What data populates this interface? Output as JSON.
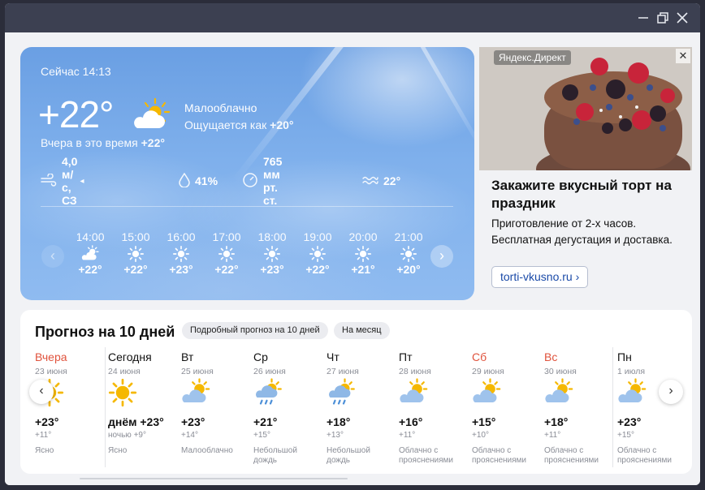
{
  "window": {
    "minimize_icon": "minimize-icon",
    "restore_icon": "restore-icon",
    "close_icon": "close-icon"
  },
  "now": {
    "label": "Сейчас 14:13",
    "temp": "+22°",
    "icon": "partly-cloudy-icon",
    "condition": "Малооблачно",
    "feels_prefix": "Ощущается как",
    "feels_value": "+20°",
    "yesterday_prefix": "Вчера в это время",
    "yesterday_value": "+22°",
    "wind": "4,0 м/с, СЗ",
    "humidity": "41%",
    "pressure": "765 мм рт. ст.",
    "water": "22°"
  },
  "hourly": [
    {
      "time": "14:00",
      "icon": "partly-cloudy-icon",
      "temp": "+22°"
    },
    {
      "time": "15:00",
      "icon": "sun-icon",
      "temp": "+22°"
    },
    {
      "time": "16:00",
      "icon": "sun-icon",
      "temp": "+23°"
    },
    {
      "time": "17:00",
      "icon": "sun-icon",
      "temp": "+22°"
    },
    {
      "time": "18:00",
      "icon": "sun-icon",
      "temp": "+23°"
    },
    {
      "time": "19:00",
      "icon": "sun-icon",
      "temp": "+22°"
    },
    {
      "time": "20:00",
      "icon": "sun-icon",
      "temp": "+21°"
    },
    {
      "time": "21:00",
      "icon": "sun-icon",
      "temp": "+20°"
    }
  ],
  "ad": {
    "tag": "Яндекс.Директ",
    "close": "✕",
    "title": "Закажите вкусный торт на праздник",
    "text": "Приготовление от 2-х часов. Бесплатная дегустация и доставка.",
    "link": "torti-vkusno.ru ›"
  },
  "forecast": {
    "title": "Прогноз на 10 дней",
    "chip_detailed": "Подробный прогноз на 10 дней",
    "chip_month": "На месяц",
    "days": [
      {
        "name": "Вчера",
        "date": "23 июня",
        "icon": "sun-icon",
        "temp": "+23°",
        "night": "+11°",
        "cond": "Ясно",
        "weekend": true
      },
      {
        "name": "Сегодня",
        "date": "24 июня",
        "icon": "sun-icon",
        "temp": "днём +23°",
        "night": "ночью +9°",
        "cond": "Ясно",
        "weekend": false
      },
      {
        "name": "Вт",
        "date": "25 июня",
        "icon": "partly-cloudy-icon",
        "temp": "+23°",
        "night": "+14°",
        "cond": "Малооблачно",
        "weekend": false
      },
      {
        "name": "Ср",
        "date": "26 июня",
        "icon": "rain-icon",
        "temp": "+21°",
        "night": "+15°",
        "cond": "Небольшой дождь",
        "weekend": false
      },
      {
        "name": "Чт",
        "date": "27 июня",
        "icon": "rain-icon",
        "temp": "+18°",
        "night": "+13°",
        "cond": "Небольшой дождь",
        "weekend": false
      },
      {
        "name": "Пт",
        "date": "28 июня",
        "icon": "partly-cloudy-icon",
        "temp": "+16°",
        "night": "+11°",
        "cond": "Облачно с прояснениями",
        "weekend": false
      },
      {
        "name": "Сб",
        "date": "29 июня",
        "icon": "partly-cloudy-icon",
        "temp": "+15°",
        "night": "+10°",
        "cond": "Облачно с прояснениями",
        "weekend": true
      },
      {
        "name": "Вс",
        "date": "30 июня",
        "icon": "partly-cloudy-icon",
        "temp": "+18°",
        "night": "+11°",
        "cond": "Облачно с прояснениями",
        "weekend": true
      },
      {
        "name": "Пн",
        "date": "1 июля",
        "icon": "partly-cloudy-icon",
        "temp": "+23°",
        "night": "+15°",
        "cond": "Облачно с прояснениями",
        "weekend": false
      }
    ]
  },
  "colors": {
    "weekend": "#e0533d",
    "accent_link": "#1a4aa8",
    "sun": "#f5b800"
  }
}
